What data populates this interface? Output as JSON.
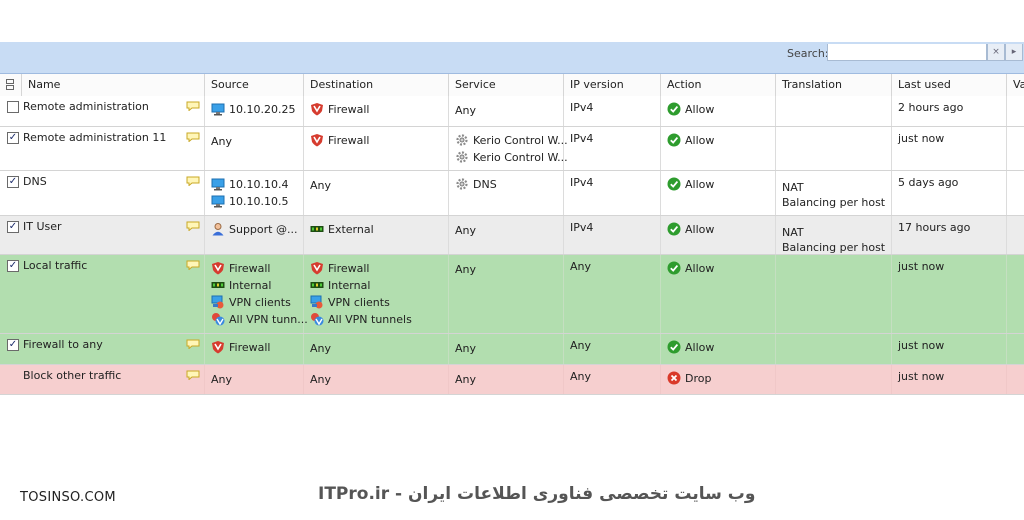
{
  "search": {
    "label": "Search:",
    "value": ""
  },
  "columns": [
    "Name",
    "Source",
    "Destination",
    "Service",
    "IP version",
    "Action",
    "Translation",
    "Last used",
    "Va"
  ],
  "rows": [
    {
      "checked": false,
      "name": "Remote administration",
      "source": [
        {
          "icon": "computer-icon",
          "text": "10.10.20.25"
        }
      ],
      "destination": [
        {
          "icon": "firewall-shield-icon",
          "text": "Firewall"
        }
      ],
      "service": [
        {
          "icon": "",
          "text": "Any"
        }
      ],
      "ip": "IPv4",
      "action": {
        "icon": "allow-check-icon",
        "text": "Allow"
      },
      "translation": [],
      "last_used": "2 hours ago"
    },
    {
      "checked": true,
      "name": "Remote administration 11",
      "source": [
        {
          "icon": "",
          "text": "Any"
        }
      ],
      "destination": [
        {
          "icon": "firewall-shield-icon",
          "text": "Firewall"
        }
      ],
      "service": [
        {
          "icon": "gear-service-icon",
          "text": "Kerio Control W..."
        },
        {
          "icon": "gear-service-icon",
          "text": "Kerio Control W..."
        }
      ],
      "ip": "IPv4",
      "action": {
        "icon": "allow-check-icon",
        "text": "Allow"
      },
      "translation": [],
      "last_used": "just now"
    },
    {
      "checked": true,
      "name": "DNS",
      "source": [
        {
          "icon": "computer-icon",
          "text": "10.10.10.4"
        },
        {
          "icon": "computer-icon",
          "text": "10.10.10.5"
        }
      ],
      "destination": [
        {
          "icon": "",
          "text": "Any"
        }
      ],
      "service": [
        {
          "icon": "gear-service-icon",
          "text": "DNS"
        }
      ],
      "ip": "IPv4",
      "action": {
        "icon": "allow-check-icon",
        "text": "Allow"
      },
      "translation": [
        "NAT",
        "Balancing per host"
      ],
      "last_used": "5 days ago"
    },
    {
      "checked": true,
      "name": "IT User",
      "source": [
        {
          "icon": "user-icon",
          "text": "Support     @..."
        }
      ],
      "destination": [
        {
          "icon": "network-interface-icon",
          "text": "External"
        }
      ],
      "service": [
        {
          "icon": "",
          "text": "Any"
        }
      ],
      "ip": "IPv4",
      "action": {
        "icon": "allow-check-icon",
        "text": "Allow"
      },
      "translation": [
        "NAT",
        "Balancing per host"
      ],
      "last_used": "17 hours ago"
    },
    {
      "checked": true,
      "name": "Local traffic",
      "source": [
        {
          "icon": "firewall-shield-icon",
          "text": "Firewall"
        },
        {
          "icon": "network-interface-icon",
          "text": "Internal"
        },
        {
          "icon": "vpn-clients-icon",
          "text": "VPN clients"
        },
        {
          "icon": "vpn-tunnels-icon",
          "text": "All VPN tunn..."
        }
      ],
      "destination": [
        {
          "icon": "firewall-shield-icon",
          "text": "Firewall"
        },
        {
          "icon": "network-interface-icon",
          "text": "Internal"
        },
        {
          "icon": "vpn-clients-icon",
          "text": "VPN clients"
        },
        {
          "icon": "vpn-tunnels-icon",
          "text": "All VPN tunnels"
        }
      ],
      "service": [
        {
          "icon": "",
          "text": "Any"
        }
      ],
      "ip": "Any",
      "action": {
        "icon": "allow-check-icon",
        "text": "Allow"
      },
      "translation": [],
      "last_used": "just now"
    },
    {
      "checked": true,
      "name": "Firewall to any",
      "source": [
        {
          "icon": "firewall-shield-icon",
          "text": "Firewall"
        }
      ],
      "destination": [
        {
          "icon": "",
          "text": "Any"
        }
      ],
      "service": [
        {
          "icon": "",
          "text": "Any"
        }
      ],
      "ip": "Any",
      "action": {
        "icon": "allow-check-icon",
        "text": "Allow"
      },
      "translation": [],
      "last_used": "just now"
    },
    {
      "checked": null,
      "name": "Block other traffic",
      "source": [
        {
          "icon": "",
          "text": "Any"
        }
      ],
      "destination": [
        {
          "icon": "",
          "text": "Any"
        }
      ],
      "service": [
        {
          "icon": "",
          "text": "Any"
        }
      ],
      "ip": "Any",
      "action": {
        "icon": "drop-x-icon",
        "text": "Drop"
      },
      "translation": [],
      "last_used": "just now"
    }
  ],
  "colors": {
    "toolbar": "#c8dcf4",
    "row_gray": "#ececec",
    "row_green": "#b2deaf",
    "row_red": "#f6cfcf",
    "allow": "#2e9c2e",
    "drop": "#d93a2a",
    "firewall": "#d63c2f"
  },
  "footer": {
    "left": "TOSINSO.COM",
    "right": "ITPro.ir - وب سایت تخصصی فناوری اطلاعات ایران"
  }
}
